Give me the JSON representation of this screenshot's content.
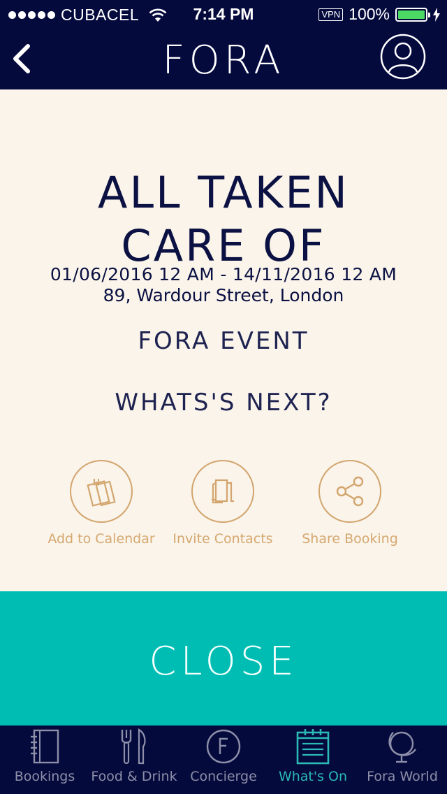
{
  "status_bar": {
    "carrier": "CUBACEL",
    "time": "7:14 PM",
    "vpn": "VPN",
    "battery": "100%"
  },
  "header": {
    "title": "FORA"
  },
  "event": {
    "title_line1": "ALL TAKEN",
    "title_line2": "CARE OF",
    "dates": "01/06/2016 12 AM - 14/11/2016 12 AM",
    "address": "89, Wardour Street, London",
    "type": "FORA EVENT"
  },
  "next": {
    "heading": "WHATS'S NEXT?",
    "actions": [
      {
        "label": "Add to Calendar",
        "icon": "calendar-book-icon"
      },
      {
        "label": "Invite Contacts",
        "icon": "contacts-card-icon"
      },
      {
        "label": "Share Booking",
        "icon": "share-icon"
      }
    ]
  },
  "close_label": "CLOSE",
  "tabs": [
    {
      "label": "Bookings",
      "icon": "notebook-icon",
      "active": false
    },
    {
      "label": "Food & Drink",
      "icon": "fork-knife-icon",
      "active": false
    },
    {
      "label": "Concierge",
      "icon": "concierge-f-icon",
      "active": false
    },
    {
      "label": "What's On",
      "icon": "calendar-icon",
      "active": true
    },
    {
      "label": "Fora World",
      "icon": "globe-icon",
      "active": false
    }
  ],
  "colors": {
    "header_bg": "#050a3d",
    "content_bg": "#faf4ea",
    "accent_gold": "#d3a56e",
    "close_teal": "#00bdb4",
    "active_tab": "#2bb9b5"
  }
}
